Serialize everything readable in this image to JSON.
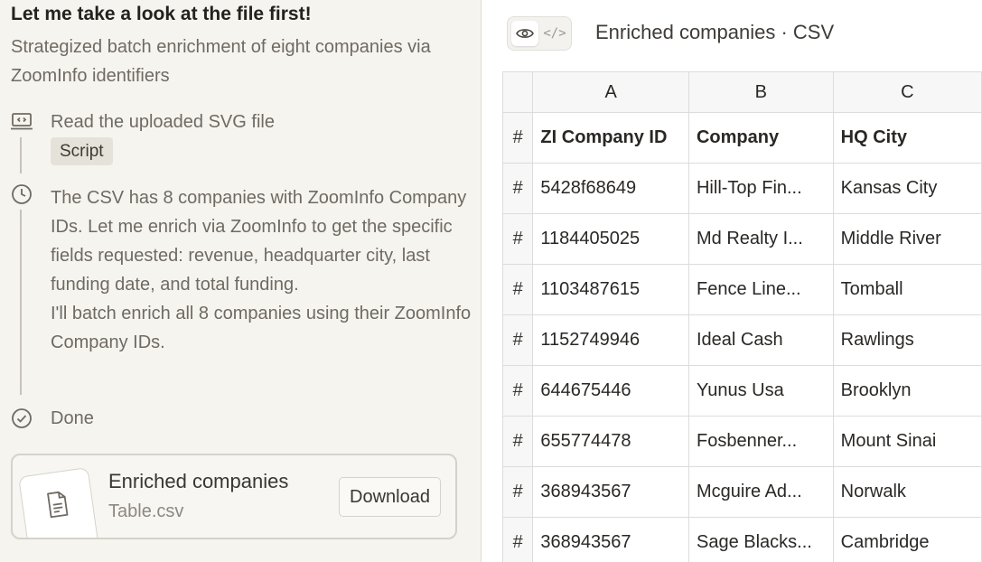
{
  "left": {
    "title": "Let me take a look at the file first!",
    "subtitle": "Strategized batch enrichment of eight companies via ZoomInfo identifiers",
    "steps": [
      {
        "icon": "code-window-icon",
        "label": "Read the uploaded SVG file",
        "tag": "Script"
      },
      {
        "icon": "clock-icon",
        "paragraph": "The CSV has 8 companies with ZoomInfo Company IDs. Let me enrich via ZoomInfo to get the specific fields requested: revenue, headquarter city, last funding date, and total funding.",
        "paragraph2": "I'll batch enrich all 8 companies using their ZoomInfo Company IDs."
      },
      {
        "icon": "check-circle-icon",
        "label": "Done"
      }
    ],
    "file_card": {
      "icon": "document-icon",
      "title": "Enriched companies",
      "subtitle": "Table.csv",
      "download_label": "Download"
    }
  },
  "right": {
    "toggle": {
      "preview_icon": "eye-icon",
      "code_icon": "code-icon",
      "code_glyph": "</>"
    },
    "title": "Enriched companies · CSV",
    "table": {
      "column_letters": [
        "A",
        "B",
        "C"
      ],
      "row_marker": "#",
      "headers": [
        "ZI Company ID",
        "Company",
        "HQ City"
      ],
      "rows": [
        [
          "5428f68649",
          "Hill-Top Fin...",
          "Kansas City"
        ],
        [
          "1184405025",
          "Md Realty I...",
          "Middle River"
        ],
        [
          "1103487615",
          "Fence Line...",
          "Tomball"
        ],
        [
          "1152749946",
          "Ideal Cash",
          "Rawlings"
        ],
        [
          "644675446",
          "Yunus Usa",
          "Brooklyn"
        ],
        [
          "655774478",
          "Fosbenner...",
          "Mount Sinai"
        ],
        [
          "368943567",
          "Mcguire Ad...",
          "Norwalk"
        ],
        [
          "368943567",
          "Sage Blacks...",
          "Cambridge"
        ]
      ]
    }
  }
}
